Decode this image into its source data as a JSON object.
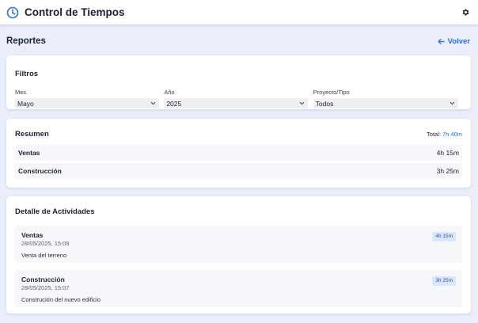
{
  "app": {
    "title": "Control de Tiempos"
  },
  "page": {
    "title": "Reportes",
    "back_label": "Volver"
  },
  "filters": {
    "title": "Filtros",
    "month": {
      "label": "Mes",
      "value": "Mayo"
    },
    "year": {
      "label": "Año",
      "value": "2025"
    },
    "project": {
      "label": "Proyecto/Tipo",
      "value": "Todos"
    }
  },
  "summary": {
    "title": "Resumen",
    "total_label": "Total:",
    "total_value": "7h 40m",
    "rows": [
      {
        "name": "Ventas",
        "duration": "4h 15m"
      },
      {
        "name": "Construcción",
        "duration": "3h 25m"
      }
    ]
  },
  "details": {
    "title": "Detalle de Actividades",
    "items": [
      {
        "name": "Ventas",
        "datetime": "28/05/2025, 15:09",
        "description": "Venta del terreno",
        "duration": "4h 15m"
      },
      {
        "name": "Construcción",
        "datetime": "28/05/2025, 15:07",
        "description": "Construción del nuevo edificio",
        "duration": "3h 25m"
      }
    ]
  },
  "icons": {
    "app": "clock-icon",
    "settings": "gear-icon",
    "back": "arrow-left-icon",
    "select": "chevron-down-icon"
  },
  "colors": {
    "accent": "#2c6fd8",
    "background": "#e9eefa",
    "badge_bg": "#dbe6fb"
  }
}
